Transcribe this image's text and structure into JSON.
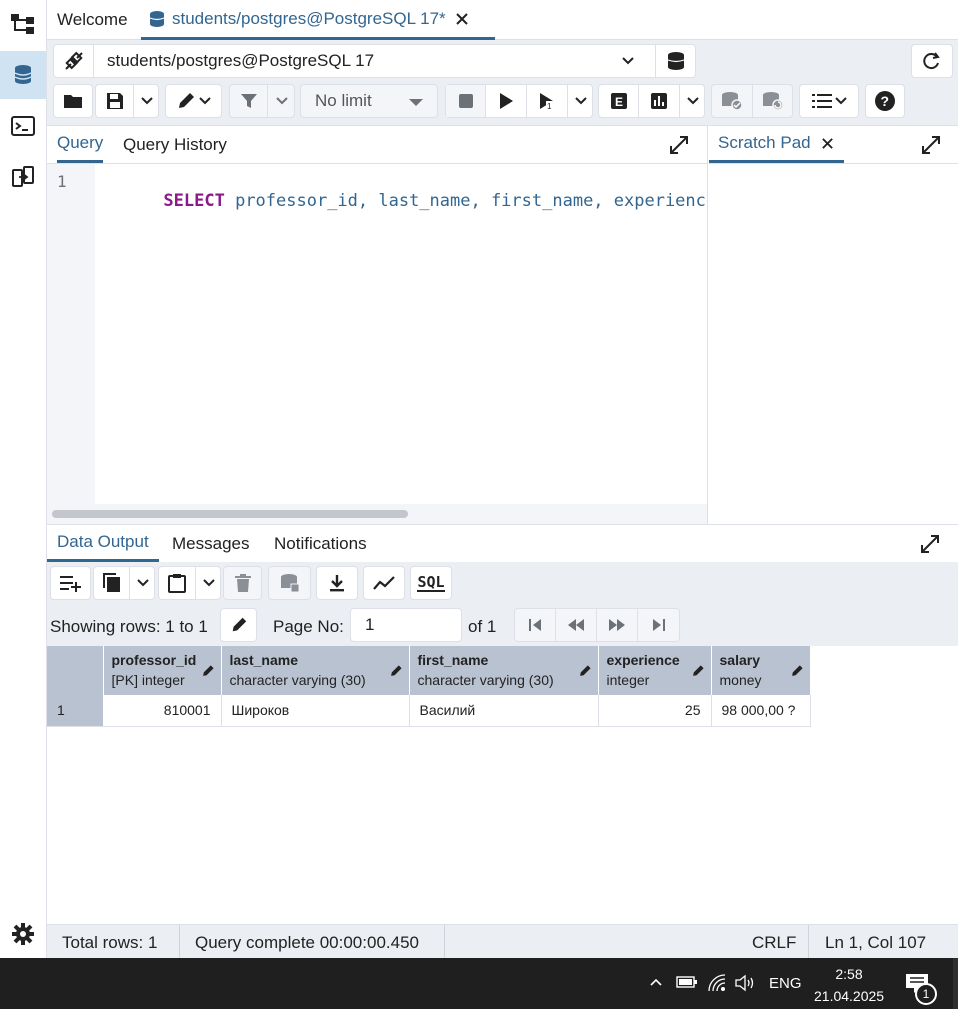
{
  "tabs": {
    "welcome": "Welcome",
    "query_tab": "students/postgres@PostgreSQL 17*"
  },
  "connection": {
    "label": "students/postgres@PostgreSQL 17"
  },
  "toolbar": {
    "limit": "No limit"
  },
  "editor": {
    "tabs": [
      "Query",
      "Query History"
    ],
    "line_number": "1",
    "code": {
      "kw": "SELECT",
      "rest": " professor_id, last_name, first_name, experience, s"
    }
  },
  "scratch": {
    "title": "Scratch Pad"
  },
  "output": {
    "tabs": [
      "Data Output",
      "Messages",
      "Notifications"
    ],
    "sql_label": "SQL",
    "showing": "Showing rows: 1 to 1",
    "page_no_label": "Page No:",
    "page_no_value": "1",
    "page_of": "of 1",
    "columns": [
      {
        "name": "professor_id",
        "type": "[PK] integer"
      },
      {
        "name": "last_name",
        "type": "character varying (30)"
      },
      {
        "name": "first_name",
        "type": "character varying (30)"
      },
      {
        "name": "experience",
        "type": "integer"
      },
      {
        "name": "salary",
        "type": "money"
      }
    ],
    "rows": [
      {
        "num": "1",
        "cells": [
          "810001",
          "Широков",
          "Василий",
          "25",
          "98 000,00 ?"
        ]
      }
    ]
  },
  "status": {
    "total_rows": "Total rows: 1",
    "query": "Query complete 00:00:00.450",
    "eol": "CRLF",
    "cursor": "Ln 1, Col 107"
  },
  "taskbar": {
    "lang": "ENG",
    "time": "2:58",
    "date": "21.04.2025",
    "notif_count": "1"
  },
  "colors": {
    "accent": "#326690",
    "toolbar_bg": "#ebeef3",
    "header_bg": "#b9c2d0",
    "keyword": "#8a1a8a"
  }
}
